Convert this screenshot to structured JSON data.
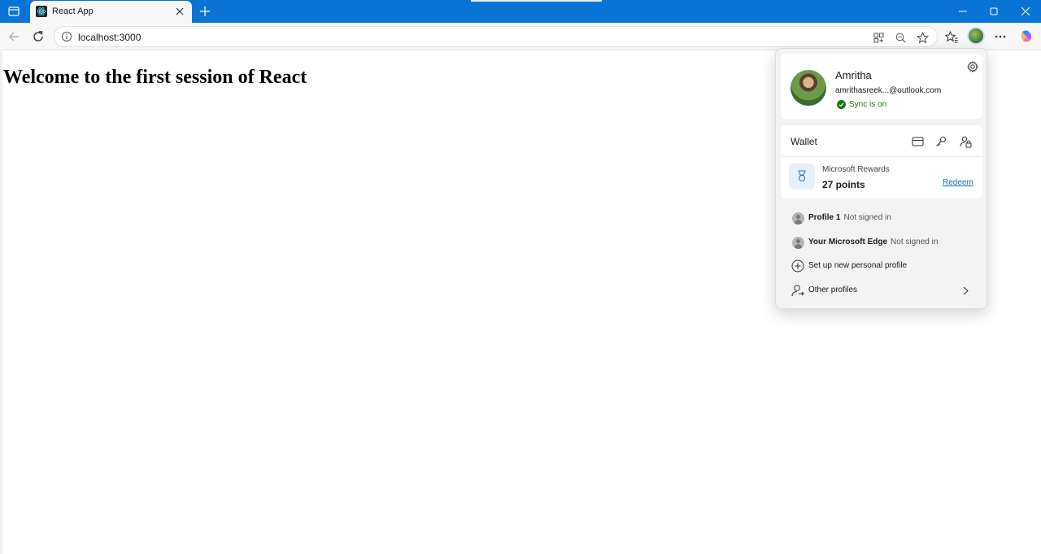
{
  "browser": {
    "tab": {
      "title": "React App"
    },
    "address": {
      "url": "localhost:3000"
    }
  },
  "page": {
    "heading": "Welcome to the first session of React"
  },
  "profile_flyout": {
    "profile": {
      "name": "Amritha",
      "email": "amrithasreek...@outlook.com",
      "sync_status": "Sync is on"
    },
    "wallet": {
      "label": "Wallet",
      "rewards_title": "Microsoft Rewards",
      "rewards_points": "27 points",
      "redeem_label": "Redeem"
    },
    "other_profiles": [
      {
        "name": "Profile 1",
        "status": "Not signed in"
      },
      {
        "name": "Your Microsoft Edge",
        "status": "Not signed in"
      }
    ],
    "actions": {
      "new_profile": "Set up new personal profile",
      "other_profiles": "Other profiles"
    }
  },
  "colors": {
    "titlebar": "#0a74d6",
    "sync_green": "#0f7b0f",
    "link_blue": "#0f6cbd"
  }
}
